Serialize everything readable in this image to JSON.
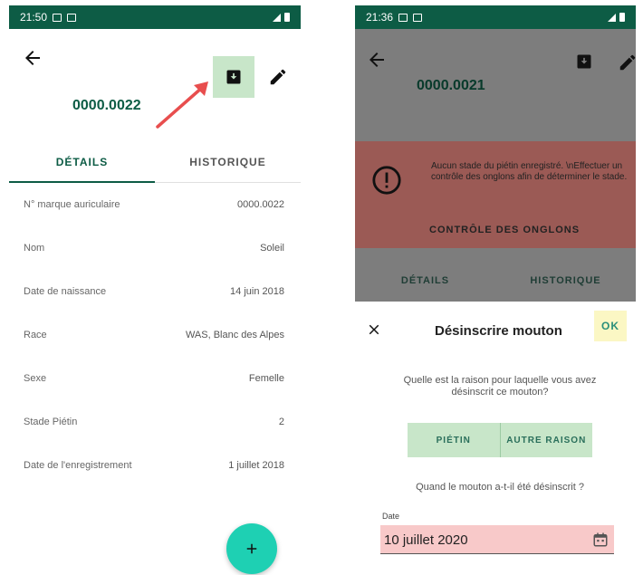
{
  "left": {
    "status_time": "21:50",
    "title": "0000.0022",
    "tabs": [
      {
        "label": "DÉTAILS",
        "active": true
      },
      {
        "label": "HISTORIQUE",
        "active": false
      }
    ],
    "rows": [
      {
        "label": "N° marque auriculaire",
        "value": "0000.0022"
      },
      {
        "label": "Nom",
        "value": "Soleil"
      },
      {
        "label": "Date de naissance",
        "value": "14 juin 2018"
      },
      {
        "label": "Race",
        "value": "WAS, Blanc des Alpes"
      },
      {
        "label": "Sexe",
        "value": "Femelle"
      },
      {
        "label": "Stade Piétin",
        "value": "2"
      },
      {
        "label": "Date de l'enregistrement",
        "value": "1 juillet 2018"
      }
    ],
    "fab_label": "+"
  },
  "right": {
    "status_time": "21:36",
    "title": "0000.0021",
    "alert": {
      "message": "Aucun stade du piétin enregistré. \\nEffectuer un contrôle des onglons afin de déterminer le stade.",
      "action": "CONTRÔLE DES ONGLONS"
    },
    "tabs": [
      "DÉTAILS",
      "HISTORIQUE"
    ],
    "dialog": {
      "title": "Désinscrire mouton",
      "ok": "OK",
      "question": "Quelle est la raison pour laquelle vous avez désinscrit ce mouton?",
      "choices": [
        "PIÉTIN",
        "AUTRE RAISON"
      ],
      "when": "Quand le mouton a-t-il été désinscrit ?",
      "date_label": "Date",
      "date_value": "10 juillet 2020"
    }
  },
  "colors": {
    "primary": "#0d5c45",
    "highlight_green": "#c8e6c9",
    "highlight_yellow": "#fbf7c4",
    "highlight_red": "#f8c9c9",
    "fab": "#1ed0b3",
    "alert": "#9b5a55",
    "annotation_arrow": "#e84e4e"
  },
  "icons": {
    "back": "arrow-left-icon",
    "archive": "archive-icon",
    "edit": "pencil-icon",
    "add": "plus-icon",
    "warning": "alert-circle-icon",
    "close": "close-icon",
    "calendar": "calendar-icon"
  }
}
